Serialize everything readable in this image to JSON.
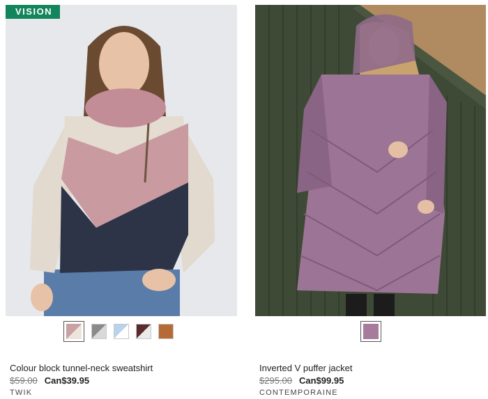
{
  "badge": {
    "label": "VISION",
    "color": "#12855c"
  },
  "products": [
    {
      "name": "Colour block tunnel-neck sweatshirt",
      "old_price": "$59.00",
      "new_price": "Can$39.95",
      "brand": "TWIK",
      "swatches": [
        {
          "name": "pink",
          "color": "#c9a1a4",
          "selected": true
        },
        {
          "name": "grey",
          "color": "#8a8a8a",
          "selected": false
        },
        {
          "name": "light-blue",
          "color": "#b9d3ec",
          "selected": false
        },
        {
          "name": "burgundy",
          "color": "#5a2a2c",
          "selected": false
        },
        {
          "name": "caramel",
          "color": "#b66a35",
          "selected": false
        }
      ]
    },
    {
      "name": "Inverted V puffer jacket",
      "old_price": "$295.00",
      "new_price": "Can$99.95",
      "brand": "CONTEMPORAINE",
      "swatches": [
        {
          "name": "mauve",
          "color": "#a77b9b",
          "selected": true
        }
      ]
    }
  ]
}
